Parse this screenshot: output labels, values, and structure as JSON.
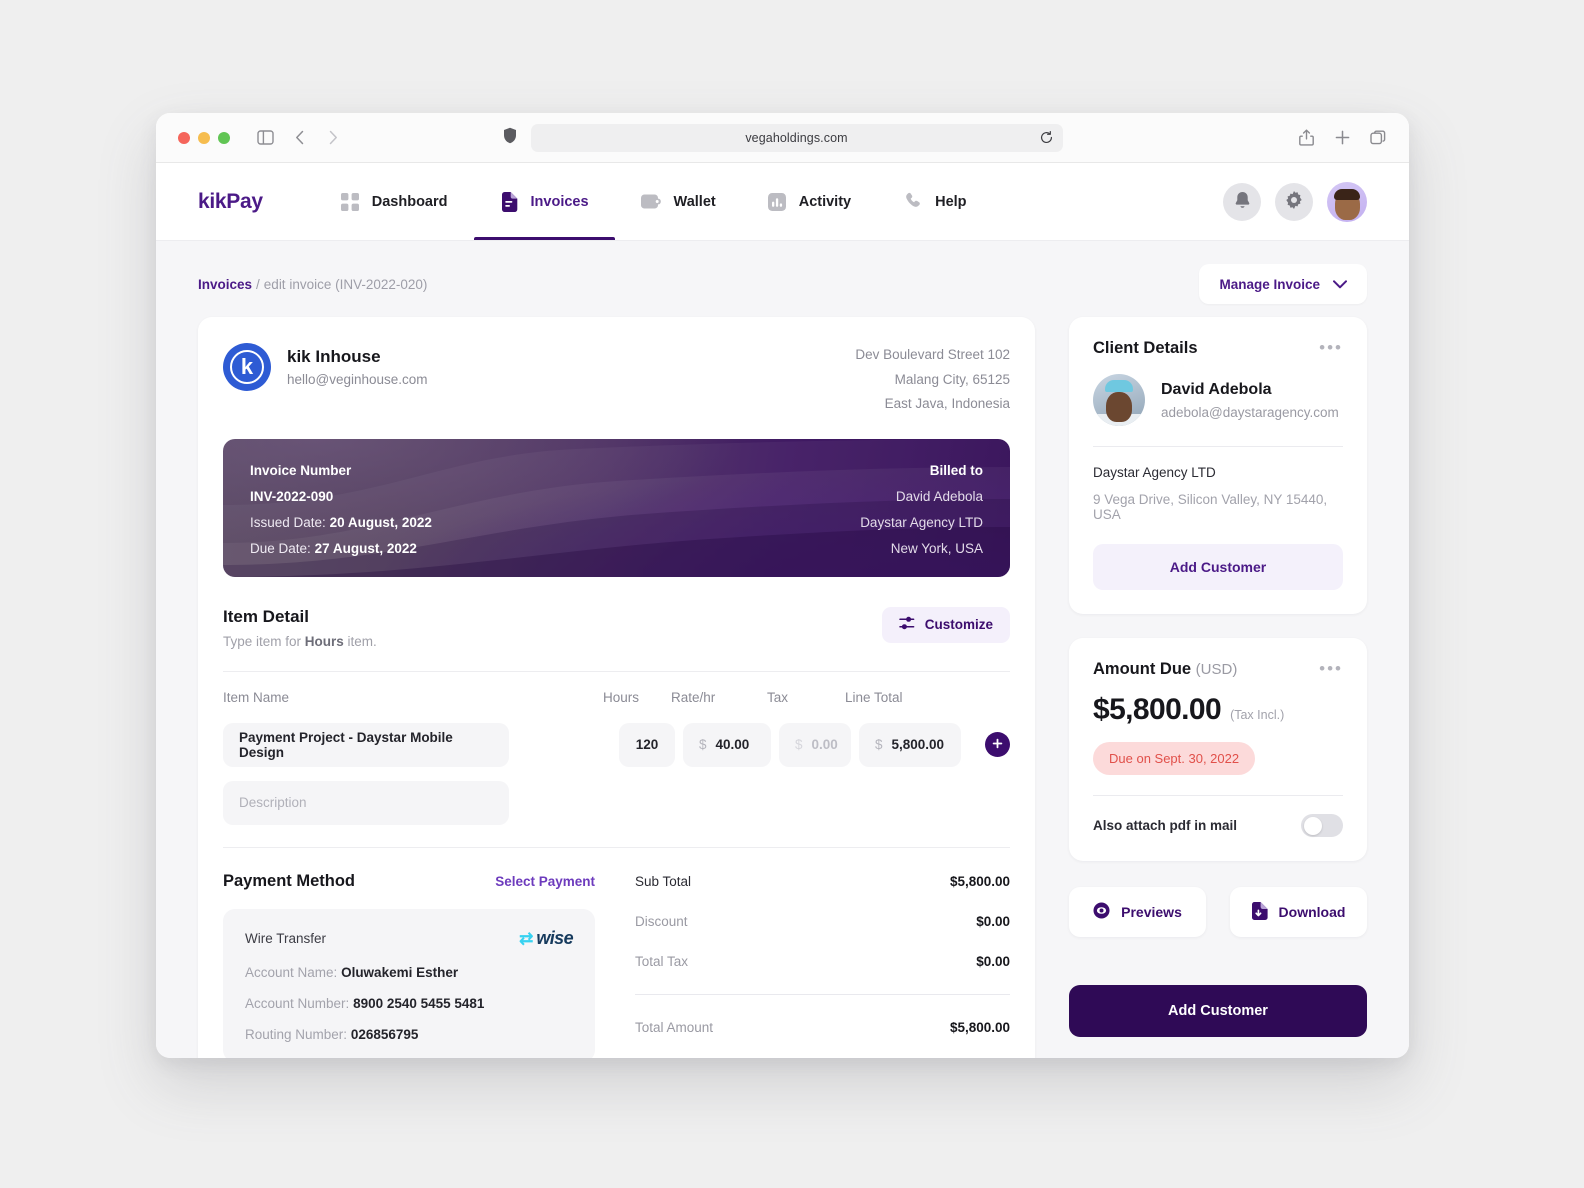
{
  "browser": {
    "url": "vegaholdings.com",
    "shield_icon": "shield-icon",
    "sidebar_icon": "sidebar-toggle-icon",
    "back_icon": "back-chevron-icon",
    "forward_icon": "forward-chevron-icon",
    "reload_icon": "reload-icon",
    "share_icon": "share-icon",
    "newtab_icon": "plus-icon",
    "tabs_icon": "tabs-icon"
  },
  "nav": {
    "logo": "kikPay",
    "items": [
      {
        "label": "Dashboard",
        "icon": "grid-icon",
        "active": false
      },
      {
        "label": "Invoices",
        "icon": "document-icon",
        "active": true
      },
      {
        "label": "Wallet",
        "icon": "wallet-icon",
        "active": false
      },
      {
        "label": "Activity",
        "icon": "chart-icon",
        "active": false
      },
      {
        "label": "Help",
        "icon": "phone-icon",
        "active": false
      }
    ],
    "notification_icon": "bell-icon",
    "settings_icon": "gear-icon",
    "avatar": "user-avatar"
  },
  "breadcrumb": {
    "root": "Invoices",
    "separator": "/",
    "current": "edit invoice (INV-2022-020)"
  },
  "manage_button": {
    "label": "Manage Invoice",
    "icon": "chevron-down-icon"
  },
  "invoice": {
    "brand": {
      "mark": "k",
      "name": "kik Inhouse",
      "email": "hello@veginhouse.com"
    },
    "address": [
      "Dev Boulevard Street 102",
      "Malang City, 65125",
      "East Java, Indonesia"
    ],
    "banner": {
      "left": {
        "number_label": "Invoice Number",
        "number": "INV-2022-090",
        "issued_label": "Issued Date:",
        "issued_value": "20 August, 2022",
        "due_label": "Due Date:",
        "due_value": "27 August, 2022"
      },
      "right": {
        "billed_to_label": "Billed to",
        "name": "David Adebola",
        "company": "Daystar Agency LTD",
        "location": "New York, USA"
      }
    },
    "item_detail": {
      "title": "Item Detail",
      "subtitle_pre": "Type item for ",
      "subtitle_bold": "Hours",
      "subtitle_post": " item.",
      "customize_label": "Customize",
      "customize_icon": "sliders-icon",
      "columns": [
        "Item Name",
        "Hours",
        "Rate/hr",
        "Tax",
        "Line Total"
      ],
      "row": {
        "name": "Payment Project - Daystar Mobile Design",
        "hours": "120",
        "currency": "$",
        "rate": "40.00",
        "tax": "0.00",
        "line_total": "5,800.00",
        "add_icon": "plus-icon"
      },
      "description_placeholder": "Description"
    },
    "payment": {
      "title": "Payment Method",
      "select_label": "Select Payment",
      "method": "Wire Transfer",
      "provider": "wise",
      "provider_mark": "⇄",
      "fields": [
        {
          "label": "Account Name",
          "value": "Oluwakemi Esther"
        },
        {
          "label": "Account Number",
          "value": "8900 2540 5455 5481"
        },
        {
          "label": "Routing Number",
          "value": "026856795"
        }
      ]
    },
    "summary": [
      {
        "label": "Sub Total",
        "value": "$5,800.00"
      },
      {
        "label": "Discount",
        "value": "$0.00"
      },
      {
        "label": "Total Tax",
        "value": "$0.00"
      }
    ],
    "total": {
      "label": "Total Amount",
      "value": "$5,800.00"
    }
  },
  "client_card": {
    "title": "Client Details",
    "menu_icon": "more-options-icon",
    "avatar": "client-avatar",
    "name": "David Adebola",
    "email": "adebola@daystaragency.com",
    "company": "Daystar Agency LTD",
    "address": "9 Vega Drive, Silicon Valley, NY 15440, USA",
    "add_customer_label": "Add Customer"
  },
  "amount_card": {
    "title": "Amount Due",
    "currency_note": "(USD)",
    "menu_icon": "more-options-icon",
    "amount": "$5,800.00",
    "tax_note": "(Tax Incl.)",
    "due_badge": "Due on Sept. 30, 2022",
    "attach_label": "Also attach pdf in mail",
    "attach_on": false
  },
  "actions": {
    "preview": {
      "label": "Previews",
      "icon": "eye-circle-icon"
    },
    "download": {
      "label": "Download",
      "icon": "file-download-icon"
    },
    "primary": "Add Customer"
  },
  "colors": {
    "brand_purple": "#4b1a87",
    "deep_purple": "#3c0d6e",
    "primary_button": "#2f0a56",
    "blue_logo": "#2e5bd4",
    "due_red": "#e1504a",
    "due_red_bg": "#fcdada"
  }
}
